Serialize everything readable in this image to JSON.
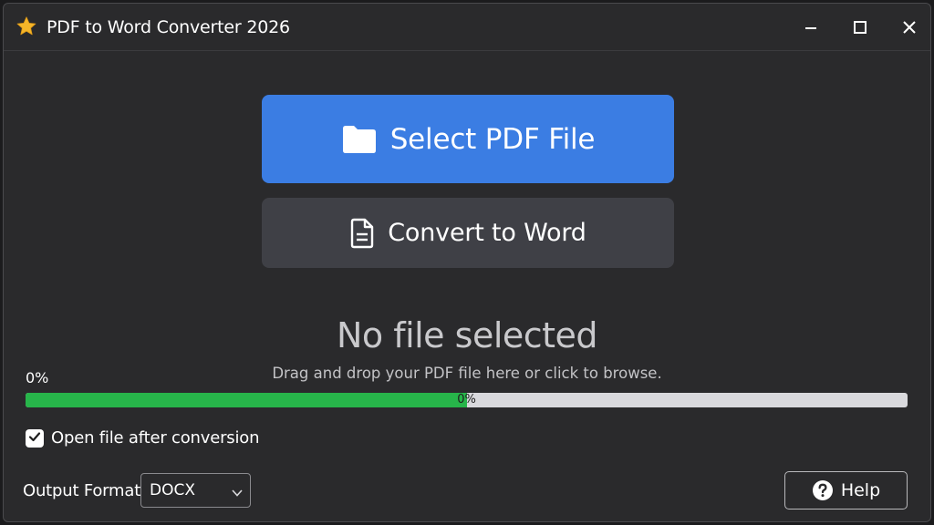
{
  "window": {
    "title": "PDF to Word Converter 2026",
    "app_icon": "star-icon",
    "controls": [
      "minimize-icon",
      "maximize-icon",
      "close-icon"
    ]
  },
  "actions": {
    "select_label": "Select PDF File",
    "select_icon": "folder-icon",
    "convert_label": "Convert to Word",
    "convert_icon": "document-icon"
  },
  "status": {
    "title": "No file selected",
    "subtitle": "Drag and drop your PDF file here or click to browse."
  },
  "progress": {
    "label": "0%",
    "bar_text": "0%",
    "fill_fraction": 0.5
  },
  "options": {
    "open_after_label": "Open file after conversion",
    "open_after_checked": true
  },
  "format": {
    "label": "Output Format",
    "selected": "DOCX"
  },
  "help": {
    "label": "Help",
    "icon": "help-circle-icon"
  },
  "colors": {
    "accent": "#3b7de3",
    "progress_fill": "#27b54a",
    "background": "#2a2a2c"
  }
}
